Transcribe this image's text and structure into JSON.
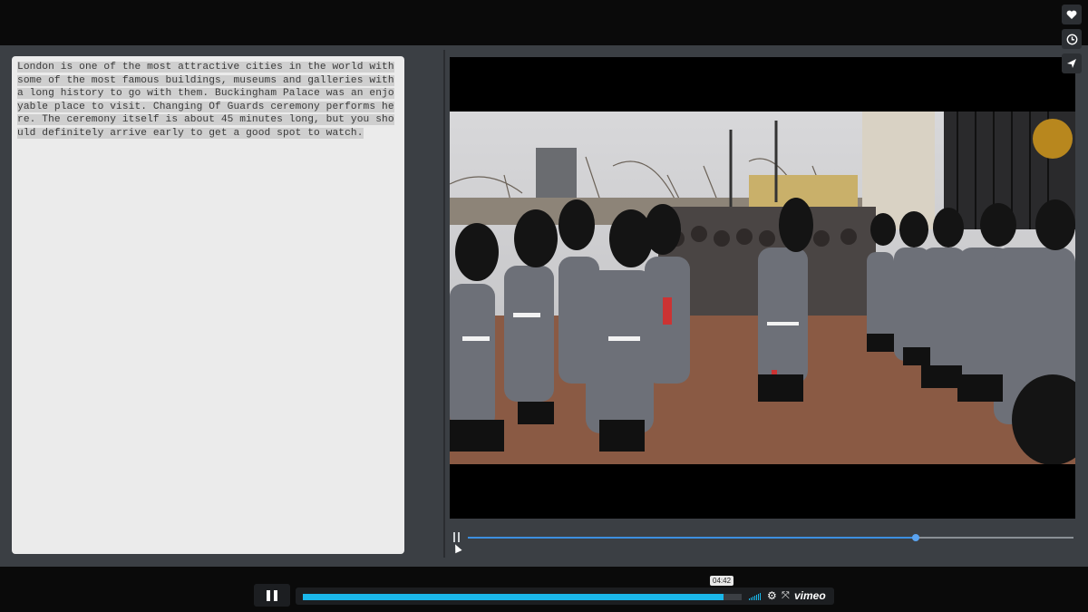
{
  "passage": {
    "plain_intro": "London is one of the most attractive cities in the world with some of the most famous buildings, museums and galleries with a long history to go with them.",
    "highlighted": " Buckingham Palace was an enjoyable place to visit. Changing Of Guards ceremony performs here. The ceremony itself is about 45 minutes long, but you should definitely arrive early to get a good spot to watch."
  },
  "video": {
    "scene_icon": "changing-of-guards-scene",
    "inner_progress_fraction": 0.74
  },
  "player": {
    "time_label": "04:42",
    "progress_fraction": 0.958,
    "brand": "vimeo"
  },
  "side_actions": [
    {
      "icon": "heart-icon",
      "glyph": "❤"
    },
    {
      "icon": "clock-icon",
      "glyph": "◷"
    },
    {
      "icon": "send-icon",
      "glyph": "➤"
    }
  ],
  "colors": {
    "accent": "#1ab7ea",
    "inner_accent": "#3d8fe0"
  }
}
